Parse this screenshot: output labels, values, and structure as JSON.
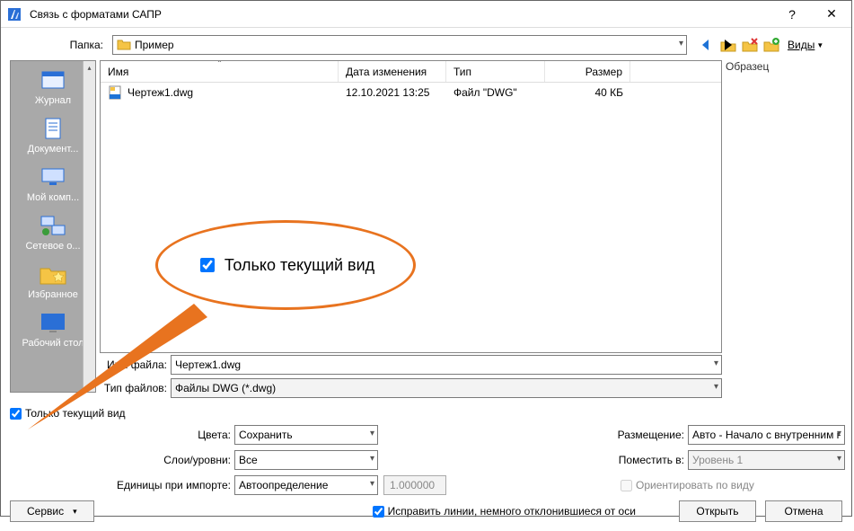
{
  "titlebar": {
    "title": "Связь с форматами САПР"
  },
  "folder_row": {
    "label": "Папка:",
    "value": "Пример",
    "views_label": "Виды"
  },
  "preview_label": "Образец",
  "places": [
    {
      "label": "Журнал"
    },
    {
      "label": "Документ..."
    },
    {
      "label": "Мой комп..."
    },
    {
      "label": "Сетевое о..."
    },
    {
      "label": "Избранное"
    },
    {
      "label": "Рабочий стол"
    }
  ],
  "columns": {
    "name": "Имя",
    "date": "Дата изменения",
    "type": "Тип",
    "size": "Размер"
  },
  "files": [
    {
      "name": "Чертеж1.dwg",
      "date": "12.10.2021 13:25",
      "type": "Файл \"DWG\"",
      "size": "40 КБ"
    }
  ],
  "filename": {
    "label": "Имя файла:",
    "value": "Чертеж1.dwg"
  },
  "filetype": {
    "label": "Тип файлов:",
    "value": "Файлы DWG  (*.dwg)"
  },
  "only_current_view": "Только текущий вид",
  "callout_text": "Только текущий вид",
  "opts": {
    "colors": {
      "label": "Цвета:",
      "value": "Сохранить"
    },
    "layers": {
      "label": "Слои/уровни:",
      "value": "Все"
    },
    "units": {
      "label": "Единицы при импорте:",
      "value": "Автоопределение",
      "num": "1.000000"
    },
    "placement": {
      "label": "Размещение:",
      "value": "Авто - Начало с внутренним началом"
    },
    "placein": {
      "label": "Поместить в:",
      "value": "Уровень 1"
    },
    "orient": {
      "label": "Ориентировать по виду"
    },
    "fixlines": {
      "label": "Исправить линии, немного отклонившиеся от оси"
    }
  },
  "buttons": {
    "service": "Сервис",
    "open": "Открыть",
    "cancel": "Отмена"
  }
}
